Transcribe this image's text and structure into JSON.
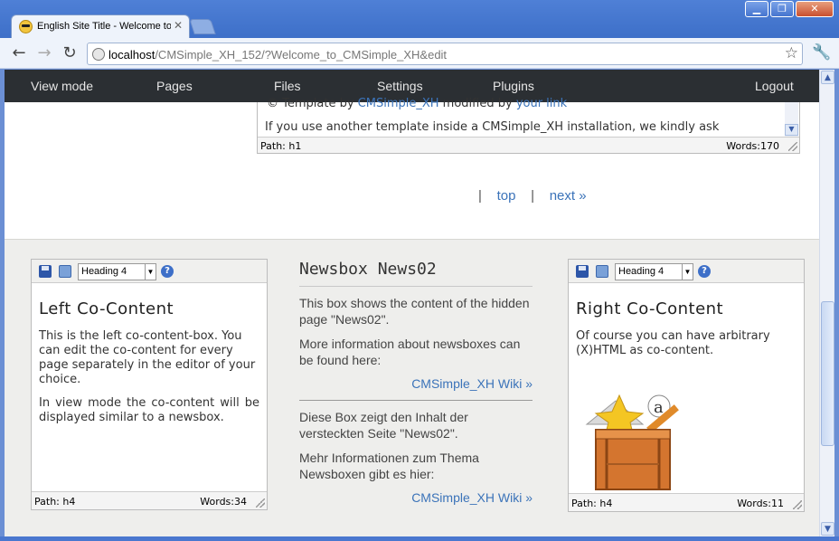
{
  "browser": {
    "tab_title": "English Site Title - Welcome to",
    "url_host": "localhost",
    "url_path": "/CMSimple_XH_152/?Welcome_to_CMSimple_XH&edit"
  },
  "adminbar": {
    "items": [
      "View mode",
      "Pages",
      "Files",
      "Settings",
      "Plugins"
    ],
    "logout": "Logout"
  },
  "main_editor": {
    "line1_prefix": "© Template by ",
    "line1_link1": "CMSimple_XH",
    "line1_mid": " modified by ",
    "line1_link2": "your link",
    "line2": "If you use another template inside a CMSimple_XH installation, we kindly ask",
    "path": "Path: h1",
    "words": "Words:170"
  },
  "pager": {
    "sep": "|",
    "top": "top",
    "next": "next »"
  },
  "left_box": {
    "format": "Heading 4",
    "heading": "Left Co-Content",
    "p1": "This is the left co-content-box. You can edit the co-content for every page separately in the editor of your choice.",
    "p2": "In view mode the co-content will be displayed similar to a newsbox.",
    "path": "Path: h4",
    "words": "Words:34"
  },
  "newsbox": {
    "title": "Newsbox News02",
    "p1": "This box shows the content of the hidden page \"News02\".",
    "p2": "More information about newsboxes can be found here:",
    "link1": "CMSimple_XH Wiki »",
    "p3": "Diese Box zeigt den Inhalt der versteckten Seite \"News02\".",
    "p4": "Mehr Informationen zum Thema Newsboxen gibt es hier:",
    "link2": "CMSimple_XH Wiki »"
  },
  "right_box": {
    "format": "Heading 4",
    "heading": "Right Co-Content",
    "p1": "Of course you can have arbitrary (X)HTML as co-content.",
    "path": "Path: h4",
    "words": "Words:11"
  }
}
